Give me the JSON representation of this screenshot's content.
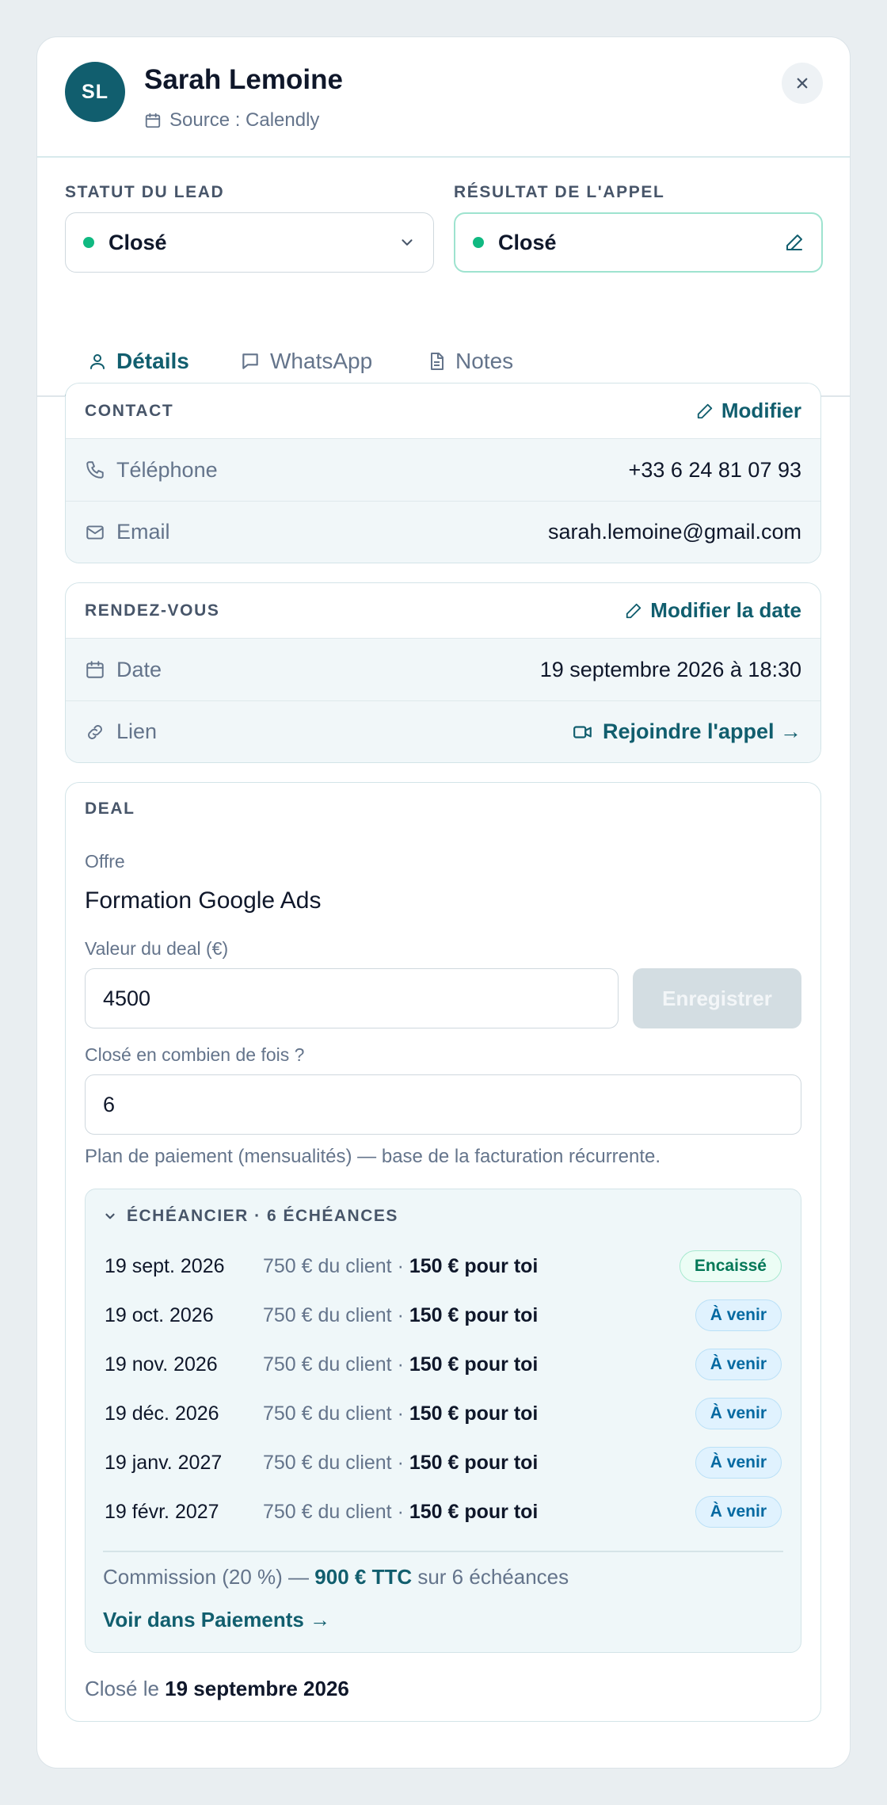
{
  "header": {
    "initials": "SL",
    "name": "Sarah Lemoine",
    "source": "Source : Calendly"
  },
  "status": {
    "lead_label": "STATUT DU LEAD",
    "lead_value": "Closé",
    "call_label": "RÉSULTAT DE L'APPEL",
    "call_value": "Closé",
    "status_color": "#10b981"
  },
  "tabs": [
    {
      "label": "Détails",
      "active": true
    },
    {
      "label": "WhatsApp",
      "active": false
    },
    {
      "label": "Notes",
      "active": false
    }
  ],
  "contact": {
    "title": "CONTACT",
    "action": "Modifier",
    "phone_label": "Téléphone",
    "phone_value": "+33 6 24 81 07 93",
    "email_label": "Email",
    "email_value": "sarah.lemoine@gmail.com"
  },
  "appointment": {
    "title": "RENDEZ-VOUS",
    "action": "Modifier la date",
    "date_label": "Date",
    "date_value": "19 septembre 2026 à 18:30",
    "link_label": "Lien",
    "link_value": "Rejoindre l'appel →"
  },
  "deal": {
    "title": "DEAL",
    "offer_label": "Offre",
    "offer_value": "Formation Google Ads",
    "value_label": "Valeur du deal (€)",
    "value_input": "4500",
    "save_label": "Enregistrer",
    "installments_label": "Closé en combien de fois ?",
    "installments_input": "6",
    "helper": "Plan de paiement (mensualités) — base de la facturation récurrente.",
    "schedule_title": "ÉCHÉANCIER · 6 ÉCHÉANCES",
    "schedule": [
      {
        "date": "19 sept. 2026",
        "client": "750 € du client · ",
        "you": "150 € pour toi",
        "status": "Encaissé",
        "kind": "paid"
      },
      {
        "date": "19 oct. 2026",
        "client": "750 € du client · ",
        "you": "150 € pour toi",
        "status": "À venir",
        "kind": "upcoming"
      },
      {
        "date": "19 nov. 2026",
        "client": "750 € du client · ",
        "you": "150 € pour toi",
        "status": "À venir",
        "kind": "upcoming"
      },
      {
        "date": "19 déc. 2026",
        "client": "750 € du client · ",
        "you": "150 € pour toi",
        "status": "À venir",
        "kind": "upcoming"
      },
      {
        "date": "19 janv. 2027",
        "client": "750 € du client · ",
        "you": "150 € pour toi",
        "status": "À venir",
        "kind": "upcoming"
      },
      {
        "date": "19 févr. 2027",
        "client": "750 € du client · ",
        "you": "150 € pour toi",
        "status": "À venir",
        "kind": "upcoming"
      }
    ],
    "commission_prefix": "Commission (20 %) — ",
    "commission_amount": "900 € TTC",
    "commission_suffix": " sur 6 échéances",
    "see_payments": "Voir dans Paiements →",
    "closed_prefix": "Closé le ",
    "closed_date": "19 septembre 2026"
  },
  "colors": {
    "brand": "#115e6e",
    "paid_text": "#047857",
    "upcoming_text": "#0369a1"
  }
}
